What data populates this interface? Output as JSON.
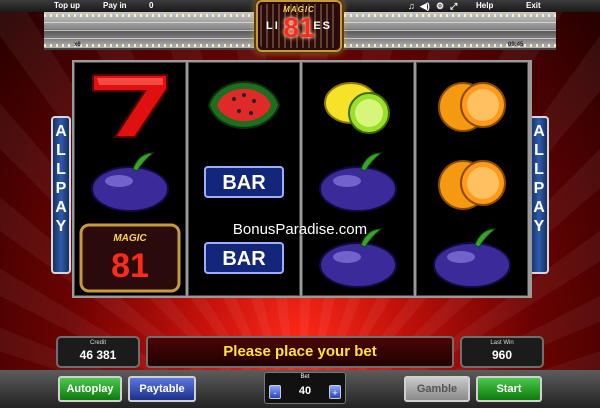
{
  "topbar": {
    "top_up": "Top up",
    "pay_in": "Pay in",
    "balance": "0",
    "help": "Help",
    "exit": "Exit",
    "icons": [
      "music-icon",
      "sound-icon",
      "settings-icon",
      "fullscreen-icon"
    ]
  },
  "header": {
    "left_small": "x6",
    "right_small": "09:45",
    "logo": {
      "magic": "MAGIC",
      "number": "81",
      "lines_left": "LI",
      "lines_right": "ES"
    }
  },
  "side_panels": {
    "left": "ALLPAY",
    "right": "ALLPAY"
  },
  "reels": [
    [
      "seven",
      "plum",
      "magic81-logo"
    ],
    [
      "watermelon",
      "bar",
      "bar"
    ],
    [
      "lemon",
      "plum",
      "plum"
    ],
    [
      "orange",
      "orange",
      "plum"
    ]
  ],
  "symbols": {
    "bar_text": "BAR",
    "logo_magic": "MAGIC",
    "logo_num": "81"
  },
  "watermark": "BonusParadise.com",
  "panels": {
    "credit_label": "Credit",
    "credit_value": "46 381",
    "message": "Please place your bet",
    "last_win_label": "Last Win",
    "last_win_value": "960"
  },
  "controls": {
    "autoplay": "Autoplay",
    "paytable": "Paytable",
    "bet_label": "Bet",
    "bet_value": "40",
    "bet_minus": "-",
    "bet_plus": "+",
    "gamble": "Gamble",
    "start": "Start"
  },
  "colors": {
    "accent_green": "#1f9a1f",
    "accent_blue": "#2a46b0",
    "message_yellow": "#ffe23a",
    "background_red": "#c0100a"
  }
}
